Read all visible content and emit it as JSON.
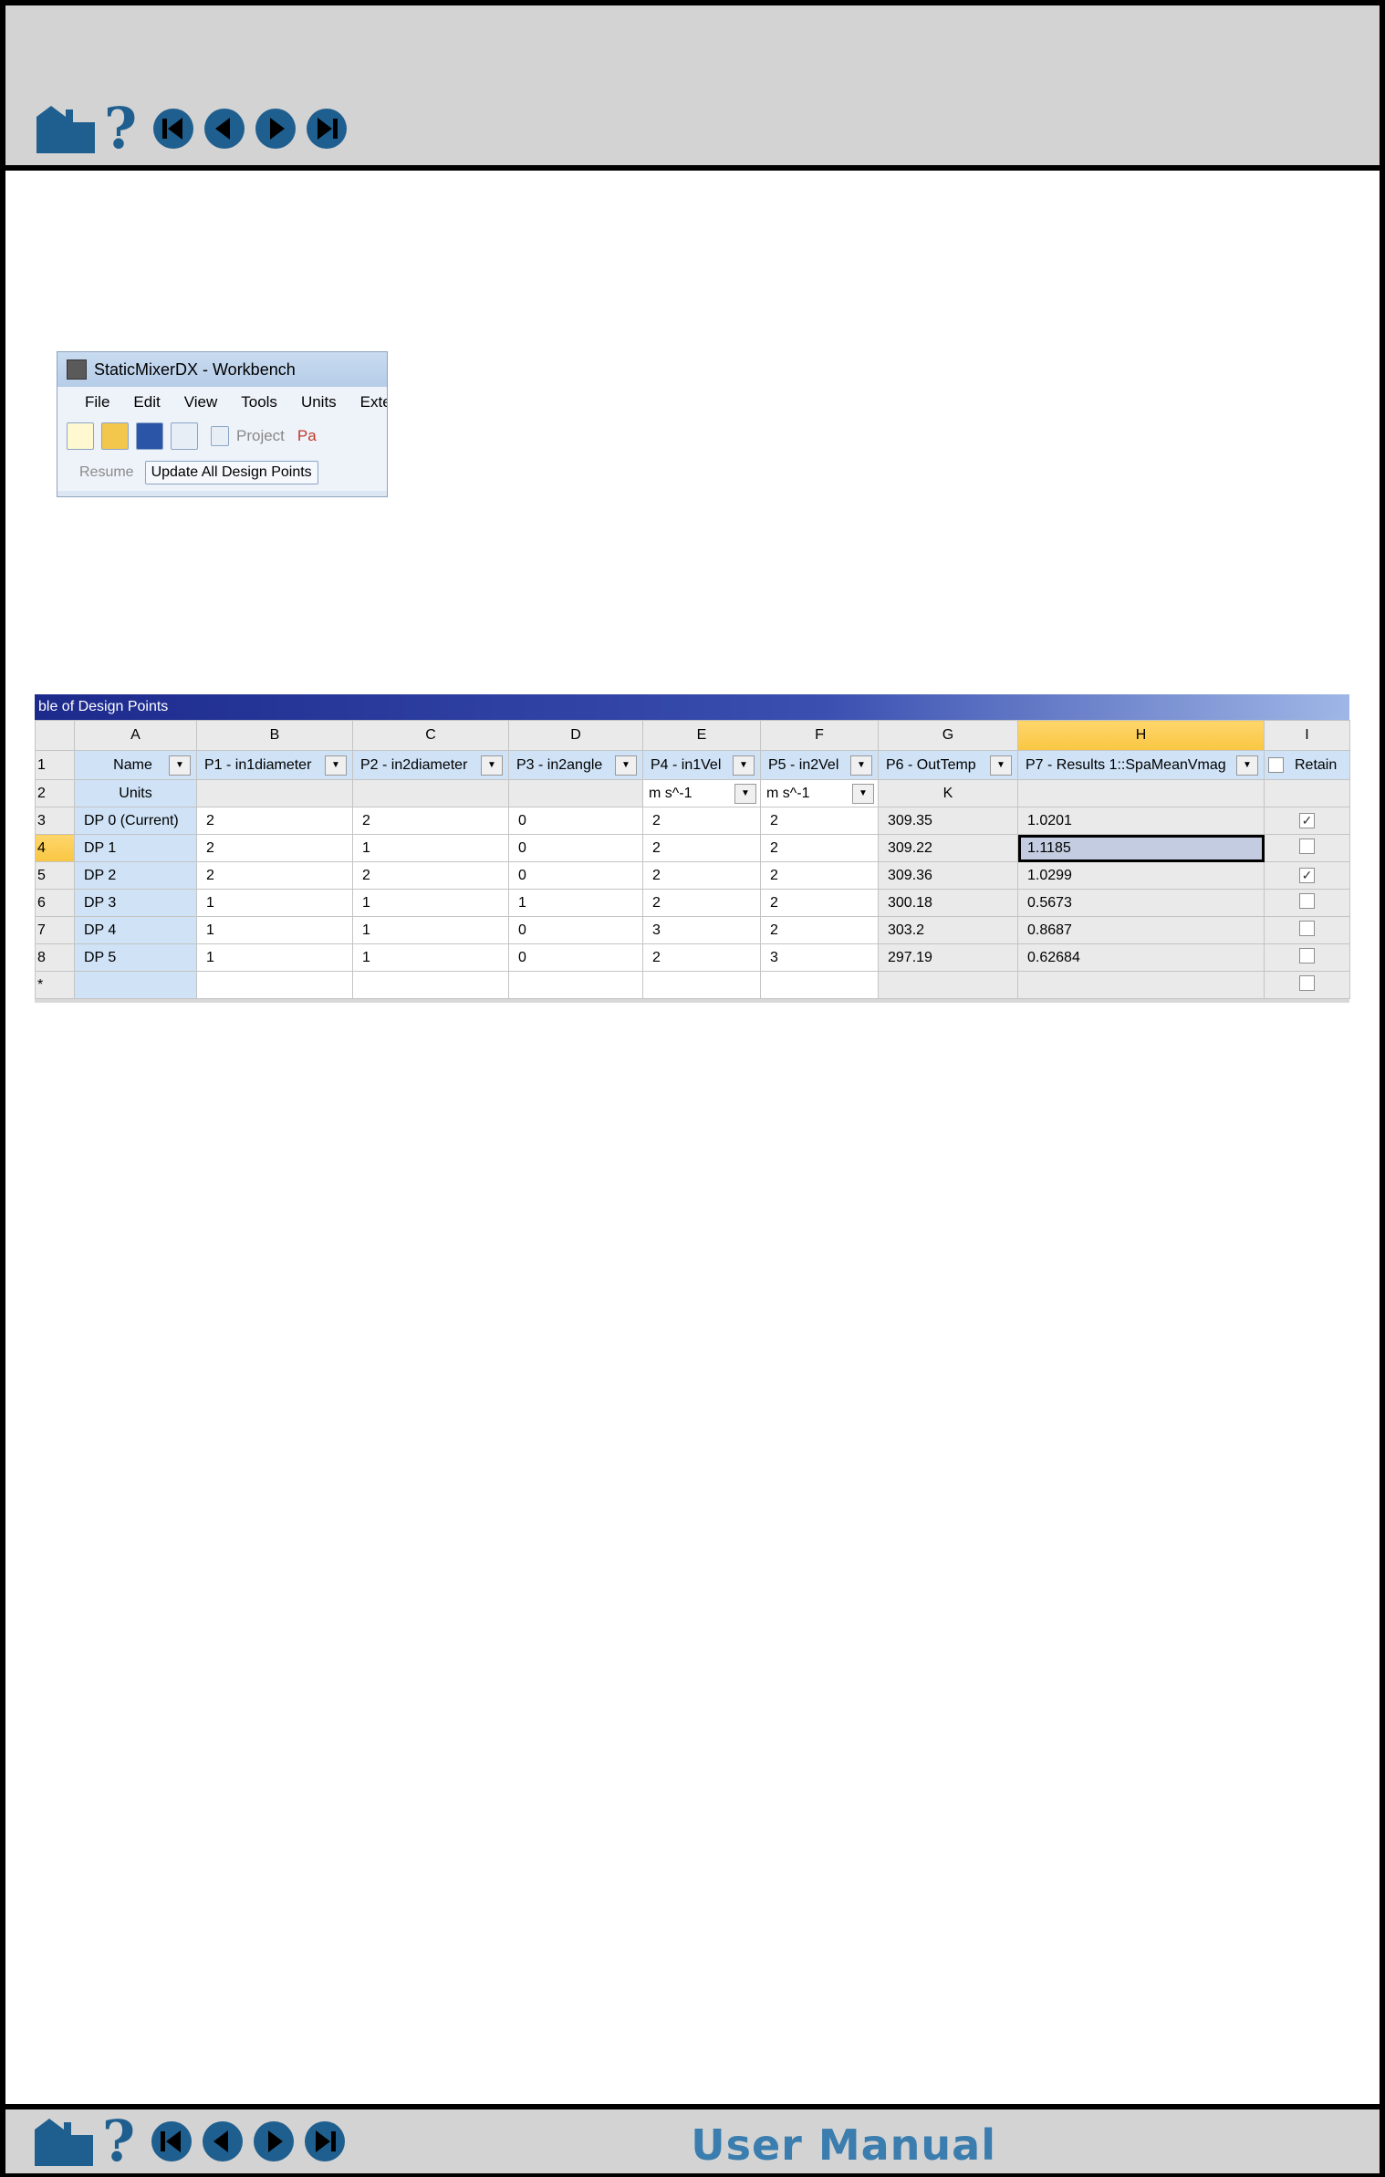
{
  "footer": {
    "manual_label": "User Manual"
  },
  "workbench": {
    "title": "StaticMixerDX - Workbench",
    "menu": [
      "File",
      "Edit",
      "View",
      "Tools",
      "Units",
      "Exte"
    ],
    "tabs": {
      "project": "Project",
      "parameters": "Pa"
    },
    "toolbar2": {
      "resume": "Resume",
      "update_all": "Update All Design Points"
    }
  },
  "table": {
    "title": "ble of Design Points",
    "columns": [
      "A",
      "B",
      "C",
      "D",
      "E",
      "F",
      "G",
      "H",
      "I"
    ],
    "row_numbers": [
      "1",
      "2",
      "3",
      "4",
      "5",
      "6",
      "7",
      "8",
      "*"
    ],
    "names": [
      "Name",
      "P1 - in1diameter",
      "P2 - in2diameter",
      "P3 - in2angle",
      "P4 - in1Vel",
      "P5 - in2Vel",
      "P6 - OutTemp",
      "P7 - Results 1::SpaMeanVmag",
      "Retain"
    ],
    "units": {
      "label": "Units",
      "e": "m s^-1",
      "f": "m s^-1",
      "g": "K"
    },
    "rows": [
      {
        "name": "DP 0 (Current)",
        "b": "2",
        "c": "2",
        "d": "0",
        "e": "2",
        "f": "2",
        "g": "309.35",
        "h": "1.0201",
        "retain": "✓"
      },
      {
        "name": "DP 1",
        "b": "2",
        "c": "1",
        "d": "0",
        "e": "2",
        "f": "2",
        "g": "309.22",
        "h": "1.1185",
        "retain": ""
      },
      {
        "name": "DP 2",
        "b": "2",
        "c": "2",
        "d": "0",
        "e": "2",
        "f": "2",
        "g": "309.36",
        "h": "1.0299",
        "retain": "✓"
      },
      {
        "name": "DP 3",
        "b": "1",
        "c": "1",
        "d": "1",
        "e": "2",
        "f": "2",
        "g": "300.18",
        "h": "0.5673",
        "retain": ""
      },
      {
        "name": "DP 4",
        "b": "1",
        "c": "1",
        "d": "0",
        "e": "3",
        "f": "2",
        "g": "303.2",
        "h": "0.8687",
        "retain": ""
      },
      {
        "name": "DP 5",
        "b": "1",
        "c": "1",
        "d": "0",
        "e": "2",
        "f": "3",
        "g": "297.19",
        "h": "0.62684",
        "retain": ""
      }
    ]
  },
  "colors": {
    "nav_blue": "#1f5f8f",
    "manual_text": "#3a7dae",
    "table_title": "#1c2a8c",
    "selected_col": "#f9c642",
    "name_cells": "#cfe2f6"
  }
}
